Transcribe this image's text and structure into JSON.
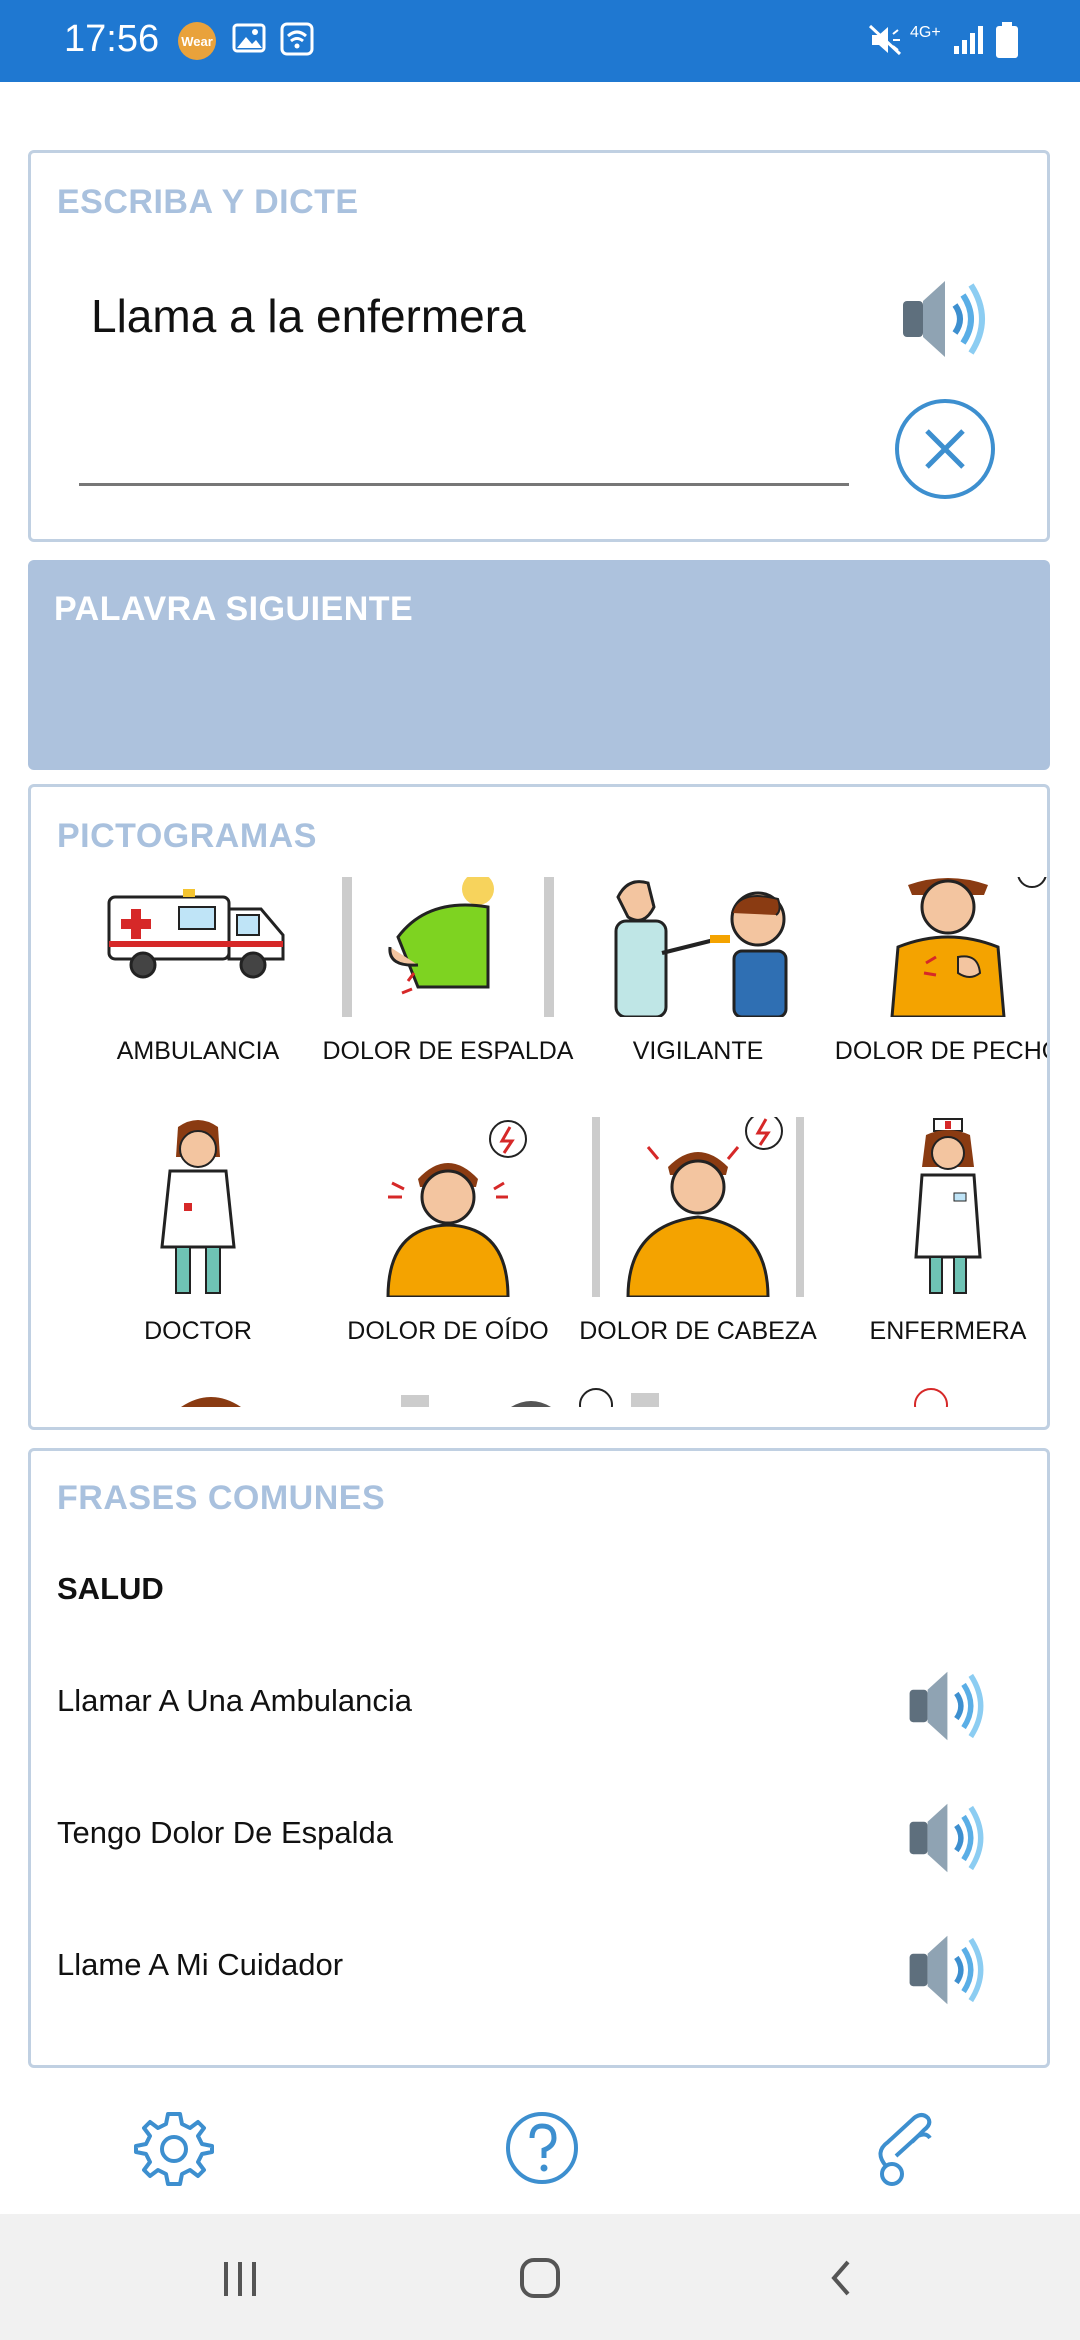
{
  "status_bar": {
    "time": "17:56",
    "wear_badge": "Wear",
    "network": "4G+",
    "icons": [
      "wear-icon",
      "image-icon",
      "wifi-icon",
      "mute-icon",
      "signal-icon",
      "battery-icon"
    ]
  },
  "escriba": {
    "title": "ESCRIBA Y DICTE",
    "input_value": "Llama a la enfermera",
    "icons": [
      "speaker-icon",
      "clear-icon"
    ]
  },
  "palavra": {
    "title": "PALAVRA SIGUIENTE"
  },
  "pictogramas": {
    "title": "PICTOGRAMAS",
    "items": [
      {
        "label": "AMBULANCIA",
        "icon": "ambulance-icon"
      },
      {
        "label": "DOLOR DE ESPALDA",
        "icon": "back-pain-icon"
      },
      {
        "label": "VIGILANTE",
        "icon": "guard-icon"
      },
      {
        "label": "DOLOR DE PECHO",
        "icon": "chest-pain-icon"
      },
      {
        "label": "DOCTOR",
        "icon": "doctor-icon"
      },
      {
        "label": "DOLOR DE OÍDO",
        "icon": "ear-pain-icon"
      },
      {
        "label": "DOLOR DE CABEZA",
        "icon": "headache-icon"
      },
      {
        "label": "ENFERMERA",
        "icon": "nurse-icon"
      }
    ]
  },
  "frases": {
    "title": "FRASES COMUNES",
    "group": "SALUD",
    "items": [
      {
        "text": "Llamar A Una Ambulancia"
      },
      {
        "text": "Tengo Dolor De Espalda"
      },
      {
        "text": "Llame A Mi Cuidador"
      }
    ]
  },
  "toolbar": {
    "icons": [
      "settings-icon",
      "help-icon",
      "sign-language-icon"
    ]
  },
  "nav": {
    "icons": [
      "recent-apps-icon",
      "home-icon",
      "back-icon"
    ]
  },
  "colors": {
    "status_bar": "#1f78d1",
    "card_border": "#c0d0e2",
    "title_light": "#a9c1de",
    "palavra_bg": "#adc2dd",
    "accent": "#3d8fcf"
  }
}
